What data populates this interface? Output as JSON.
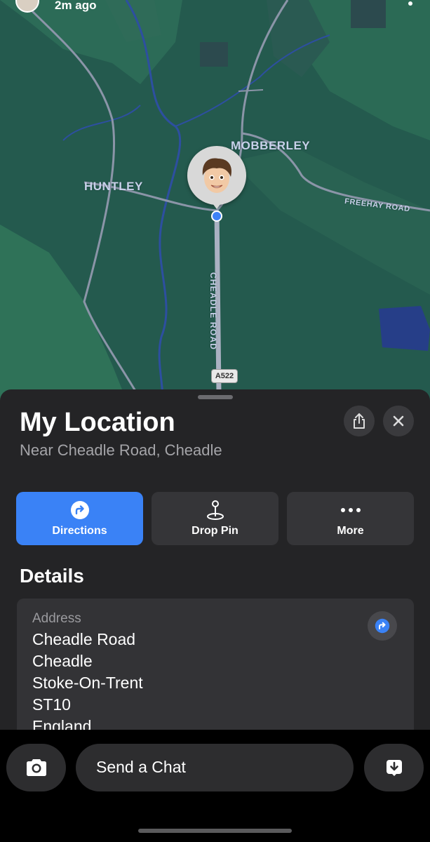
{
  "map": {
    "time_ago": "2m ago",
    "labels": {
      "huntley": "HUNTLEY",
      "mobberley": "MOBBERLEY",
      "freehay_road": "FREEHAY ROAD",
      "cheadle_road": "CHEADLE ROAD",
      "road_number": "A522"
    },
    "location_dot_color": "#3d82f6"
  },
  "sheet": {
    "title": "My Location",
    "subtitle": "Near Cheadle Road, Cheadle",
    "share_icon": "share-icon",
    "close_icon": "close-icon",
    "actions": [
      {
        "label": "Directions",
        "icon": "directions-icon",
        "color": "#3a82f6"
      },
      {
        "label": "Drop Pin",
        "icon": "drop-pin-icon"
      },
      {
        "label": "More",
        "icon": "more-icon"
      }
    ],
    "details_heading": "Details",
    "address": {
      "label": "Address",
      "lines": [
        "Cheadle Road",
        "Cheadle",
        "Stoke-On-Trent",
        "ST10",
        "England"
      ]
    }
  },
  "bottom_bar": {
    "chat_placeholder": "Send a Chat",
    "camera_icon": "camera-icon",
    "drop_icon": "download-icon"
  }
}
